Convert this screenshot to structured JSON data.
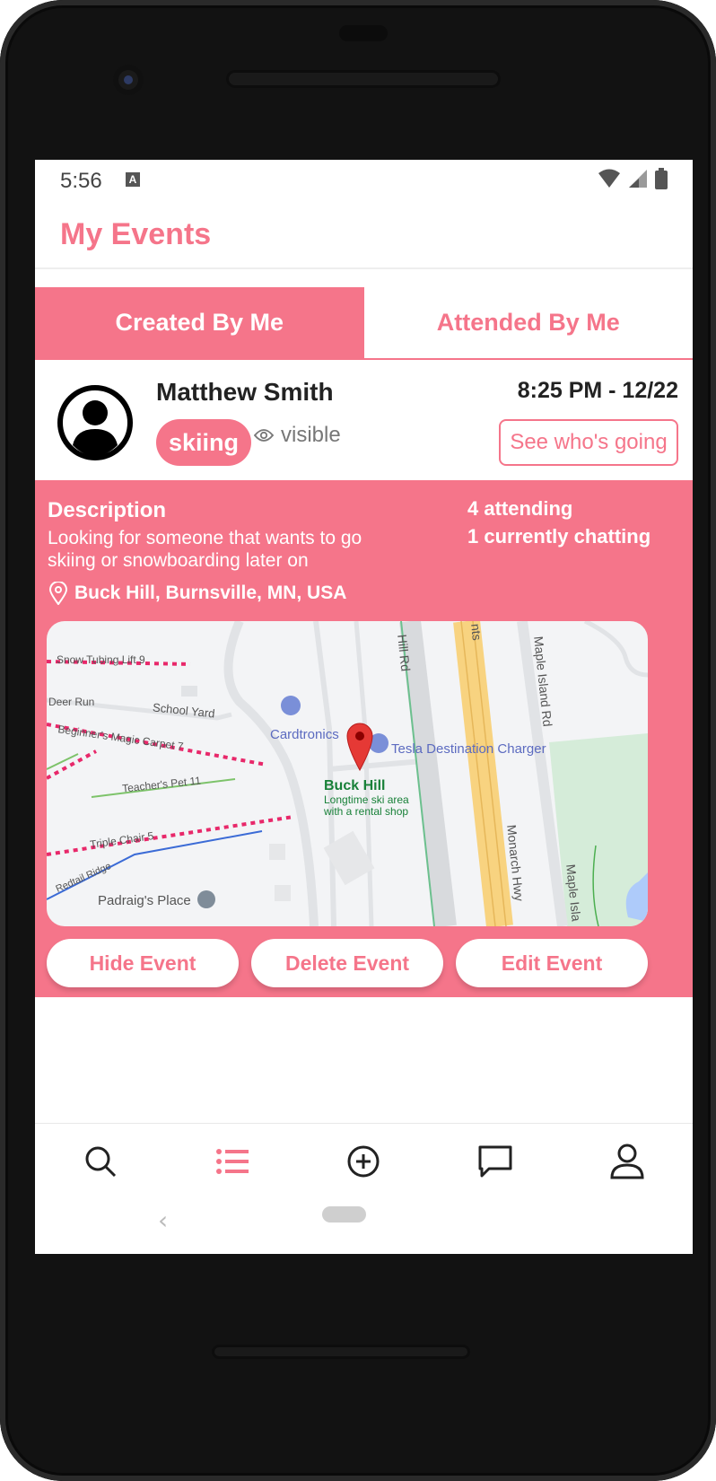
{
  "status_bar": {
    "time": "5:56",
    "a_badge": "A",
    "icons": [
      "wifi-icon",
      "signal-icon",
      "battery-icon"
    ]
  },
  "header": {
    "title": "My Events"
  },
  "tabs": [
    {
      "label": "Created By Me",
      "active": true
    },
    {
      "label": "Attended By Me",
      "active": false
    }
  ],
  "event": {
    "host": "Matthew Smith",
    "time": "8:25 PM - 12/22",
    "tag": "skiing",
    "visibility": "visible",
    "see_going_label": "See who's going",
    "description_title": "Description",
    "description": "Looking for someone that wants to go skiing or snowboarding later on",
    "attending": "4 attending",
    "chatting": "1 currently chatting",
    "location": "Buck Hill, Burnsville, MN, USA",
    "map": {
      "labels": {
        "snow_tubing": "Snow Tubing Lift 9",
        "deer_run": "Deer Run",
        "school_yard": "School Yard",
        "beginners": "Beginner's Magic Carpet 7",
        "teachers_pet": "Teacher's Pet 11",
        "triple_chair": "Triple Chair 5",
        "redtail": "Redtail Ridge",
        "padraigs": "Padraig's Place",
        "cardtronics": "Cardtronics",
        "tesla": "Tesla Destination Charger",
        "buck_hill": "Buck Hill",
        "buck_hill_desc_1": "Longtime ski area",
        "buck_hill_desc_2": "with a rental shop",
        "hill_rd": "Hill Rd",
        "nts": "nts",
        "maple_island_rd": "Maple Island Rd",
        "monarch_hwy": "Monarch Hwy",
        "maple_isla": "Maple Isla"
      }
    },
    "actions": {
      "hide": "Hide Event",
      "delete": "Delete Event",
      "edit": "Edit Event"
    }
  },
  "colors": {
    "accent": "#f5758a",
    "highway": "#f8d380",
    "park": "#d5ecd9"
  },
  "bottom_nav": [
    {
      "icon": "search-icon",
      "active": false
    },
    {
      "icon": "list-icon",
      "active": true
    },
    {
      "icon": "add-circle-icon",
      "active": false
    },
    {
      "icon": "chat-icon",
      "active": false
    },
    {
      "icon": "profile-icon",
      "active": false
    }
  ]
}
